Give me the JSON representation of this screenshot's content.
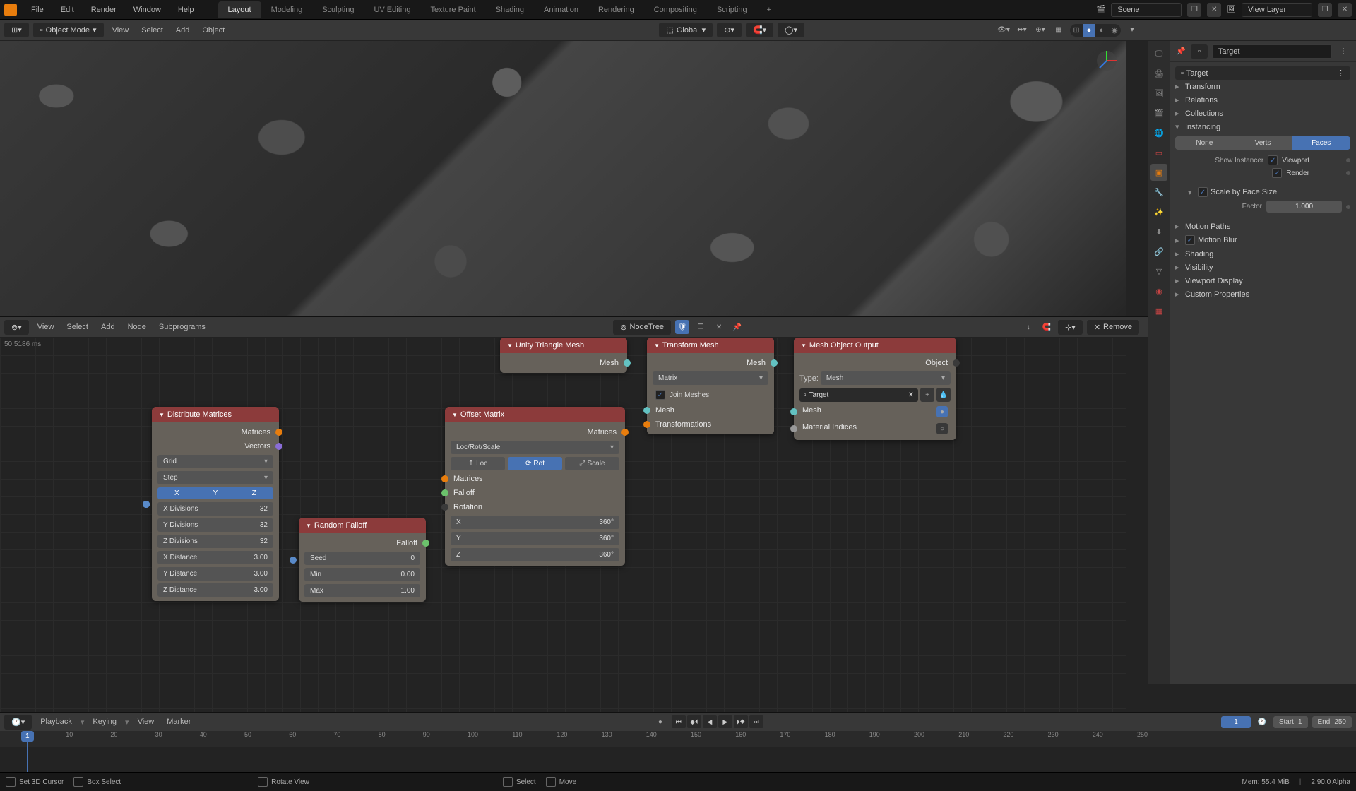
{
  "topmenu": [
    "File",
    "Edit",
    "Render",
    "Window",
    "Help"
  ],
  "workspaces": [
    "Layout",
    "Modeling",
    "Sculpting",
    "UV Editing",
    "Texture Paint",
    "Shading",
    "Animation",
    "Rendering",
    "Compositing",
    "Scripting"
  ],
  "active_workspace": "Layout",
  "scene_label": "Scene",
  "viewlayer_label": "View Layer",
  "header2": {
    "mode": "Object Mode",
    "menus": [
      "View",
      "Select",
      "Add",
      "Object"
    ],
    "orientation": "Global"
  },
  "props_header": {
    "object": "Target"
  },
  "breadcrumb": {
    "obj": "Target",
    "icon": "▫"
  },
  "panels": {
    "transform": "Transform",
    "relations": "Relations",
    "collections": "Collections",
    "instancing": "Instancing",
    "motion_paths": "Motion Paths",
    "motion_blur": "Motion Blur",
    "shading": "Shading",
    "visibility": "Visibility",
    "viewport_display": "Viewport Display",
    "custom_props": "Custom Properties"
  },
  "instancing": {
    "tabs": [
      "None",
      "Verts",
      "Faces"
    ],
    "active": "Faces",
    "show_instancer": "Show Instancer",
    "viewport": "Viewport",
    "render": "Render",
    "scale_face": "Scale by Face Size",
    "factor_label": "Factor",
    "factor_val": "1.000"
  },
  "node_editor": {
    "menus": [
      "View",
      "Select",
      "Add",
      "Node",
      "Subprograms"
    ],
    "tree": "NodeTree",
    "perf": "50.5186 ms",
    "remove": "Remove"
  },
  "nodes": {
    "distribute": {
      "title": "Distribute Matrices",
      "out1": "Matrices",
      "out2": "Vectors",
      "mode": "Grid",
      "dist": "Step",
      "axes": [
        "X",
        "Y",
        "Z"
      ],
      "xdiv_l": "X Divisions",
      "xdiv_v": "32",
      "ydiv_l": "Y Divisions",
      "ydiv_v": "32",
      "zdiv_l": "Z Divisions",
      "zdiv_v": "32",
      "xdist_l": "X Distance",
      "xdist_v": "3.00",
      "ydist_l": "Y Distance",
      "ydist_v": "3.00",
      "zdist_l": "Z Distance",
      "zdist_v": "3.00"
    },
    "random": {
      "title": "Random Falloff",
      "out": "Falloff",
      "seed_l": "Seed",
      "seed_v": "0",
      "min_l": "Min",
      "min_v": "0.00",
      "max_l": "Max",
      "max_v": "1.00"
    },
    "offset": {
      "title": "Offset Matrix",
      "out": "Matrices",
      "mode": "Loc/Rot/Scale",
      "loc": "Loc",
      "rot": "Rot",
      "scale": "Scale",
      "in_mat": "Matrices",
      "in_fall": "Falloff",
      "in_rot": "Rotation",
      "x_l": "X",
      "x_v": "360°",
      "y_l": "Y",
      "y_v": "360°",
      "z_l": "Z",
      "z_v": "360°"
    },
    "unity": {
      "title": "Unity Triangle Mesh",
      "out": "Mesh"
    },
    "transform": {
      "title": "Transform Mesh",
      "out": "Mesh",
      "mode": "Matrix",
      "join_l": "Join Meshes",
      "in_mesh": "Mesh",
      "in_trans": "Transformations"
    },
    "output": {
      "title": "Mesh Object Output",
      "out": "Object",
      "type_l": "Type:",
      "type_v": "Mesh",
      "obj": "Target",
      "in_mesh": "Mesh",
      "in_mat": "Material Indices"
    }
  },
  "timeline": {
    "menus": [
      "Playback",
      "Keying",
      "View",
      "Marker"
    ],
    "cur": "1",
    "start_l": "Start",
    "start_v": "1",
    "end_l": "End",
    "end_v": "250",
    "ticks": [
      1,
      10,
      20,
      30,
      40,
      50,
      60,
      70,
      80,
      90,
      100,
      110,
      120,
      130,
      140,
      150,
      160,
      170,
      180,
      190,
      200,
      210,
      220,
      230,
      240,
      250
    ]
  },
  "status": {
    "items": [
      "Set 3D Cursor",
      "Box Select",
      "Rotate View",
      "Select",
      "Move"
    ],
    "mem": "Mem: 55.4 MiB",
    "ver": "2.90.0 Alpha"
  }
}
